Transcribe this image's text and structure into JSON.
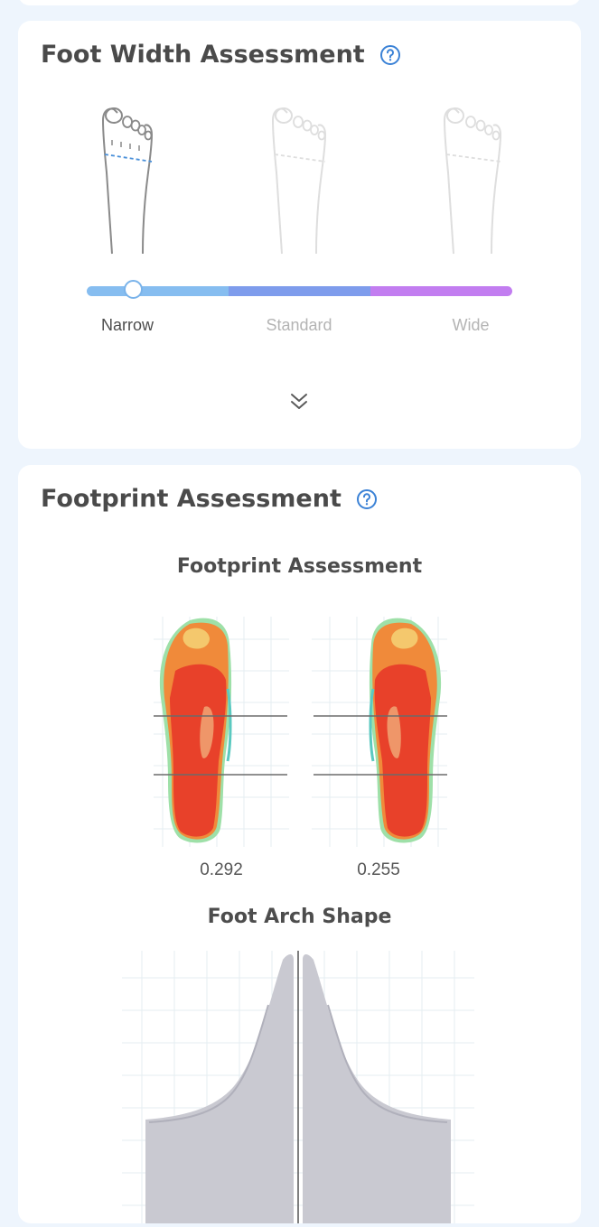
{
  "foot_width": {
    "title": "Foot Width Assessment",
    "help_icon": "help-circle-icon",
    "levels": [
      {
        "label": "Narrow",
        "active": true
      },
      {
        "label": "Standard",
        "active": false
      },
      {
        "label": "Wide",
        "active": false
      }
    ],
    "selected_level": "Narrow",
    "slider_position": 0.11,
    "slider_colors": [
      "#86bdf0",
      "#7e9cec",
      "#c27df0"
    ],
    "expand_icon": "double-chevron-down-icon"
  },
  "footprint": {
    "title": "Footprint Assessment",
    "help_icon": "help-circle-icon",
    "chart_title": "Footprint Assessment",
    "left_value": "0.292",
    "right_value": "0.255",
    "arch_title": "Foot Arch Shape"
  },
  "colors": {
    "page_background": "#eef5fd",
    "accent": "#3b82d6",
    "heatmap_high": "#e8412a"
  }
}
